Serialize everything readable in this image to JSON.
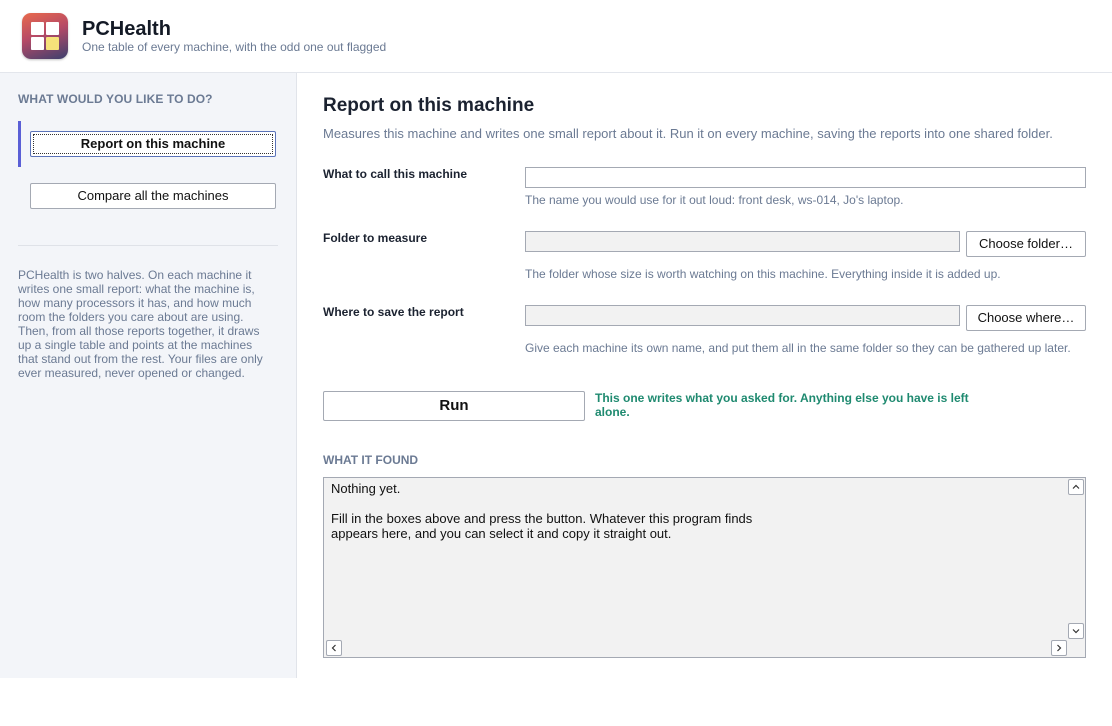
{
  "app": {
    "title": "PCHealth",
    "subtitle": "One table of every machine, with the odd one out flagged",
    "logo_icon": "app-grid-logo-icon"
  },
  "sidebar": {
    "heading": "WHAT WOULD YOU LIKE TO DO?",
    "items": [
      {
        "label": "Report on this machine",
        "active": true
      },
      {
        "label": "Compare all the machines",
        "active": false
      }
    ],
    "about": "PCHealth is two halves. On each machine it writes one small report: what the machine is, how many processors it has, and how much room the folders you care about are using. Then, from all those reports together, it draws up a single table and points at the machines that stand out from the rest. Your files are only ever measured, never opened or changed."
  },
  "main": {
    "title": "Report on this machine",
    "description": "Measures this machine and writes one small report about it. Run it on every machine, saving the reports into one shared folder.",
    "fields": {
      "machine_name": {
        "label": "What to call this machine",
        "value": "",
        "help": "The name you would use for it out loud: front desk, ws-014, Jo's laptop."
      },
      "folder": {
        "label": "Folder to measure",
        "value": "",
        "button": "Choose folder…",
        "help": "The folder whose size is worth watching on this machine. Everything inside it is added up."
      },
      "save_to": {
        "label": "Where to save the report",
        "value": "",
        "button": "Choose where…",
        "help": "Give each machine its own name, and put them all in the same folder so they can be gathered up later."
      }
    },
    "run": {
      "label": "Run",
      "note": "This one writes what you asked for. Anything else you have is left alone."
    },
    "output": {
      "heading": "WHAT IT FOUND",
      "text": "Nothing yet.\n\nFill in the boxes above and press the button. Whatever this program finds\nappears here, and you can select it and copy it straight out."
    }
  },
  "colors": {
    "accent": "#5a5fd6",
    "note_green": "#1f8a70",
    "muted_text": "#6b7a93",
    "sidebar_bg": "#f3f5f9"
  }
}
